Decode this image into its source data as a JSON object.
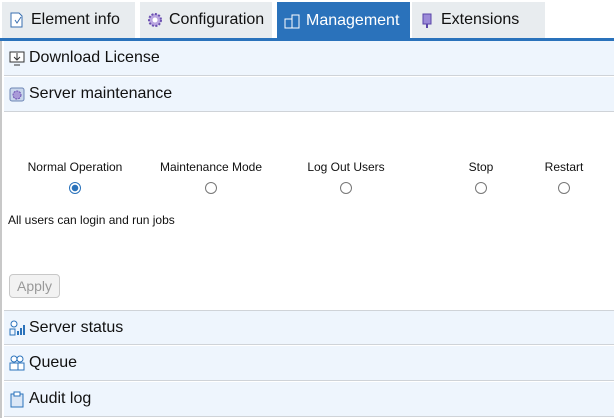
{
  "tabs": [
    {
      "label": "Element info",
      "icon": "document-icon"
    },
    {
      "label": "Configuration",
      "icon": "gear-icon"
    },
    {
      "label": "Management",
      "icon": "management-icon",
      "active": true
    },
    {
      "label": "Extensions",
      "icon": "plugin-icon"
    }
  ],
  "sections": {
    "download_license": "Download License",
    "server_maintenance": "Server maintenance",
    "server_status": "Server status",
    "queue": "Queue",
    "audit_log": "Audit log"
  },
  "maintenance": {
    "options": [
      "Normal Operation",
      "Maintenance Mode",
      "Log Out Users",
      "Stop",
      "Restart"
    ],
    "selected": "Normal Operation",
    "description": "All users can login and run jobs",
    "apply_label": "Apply"
  },
  "colors": {
    "accent": "#2a72bb",
    "section_bg": "#eef5fd"
  }
}
